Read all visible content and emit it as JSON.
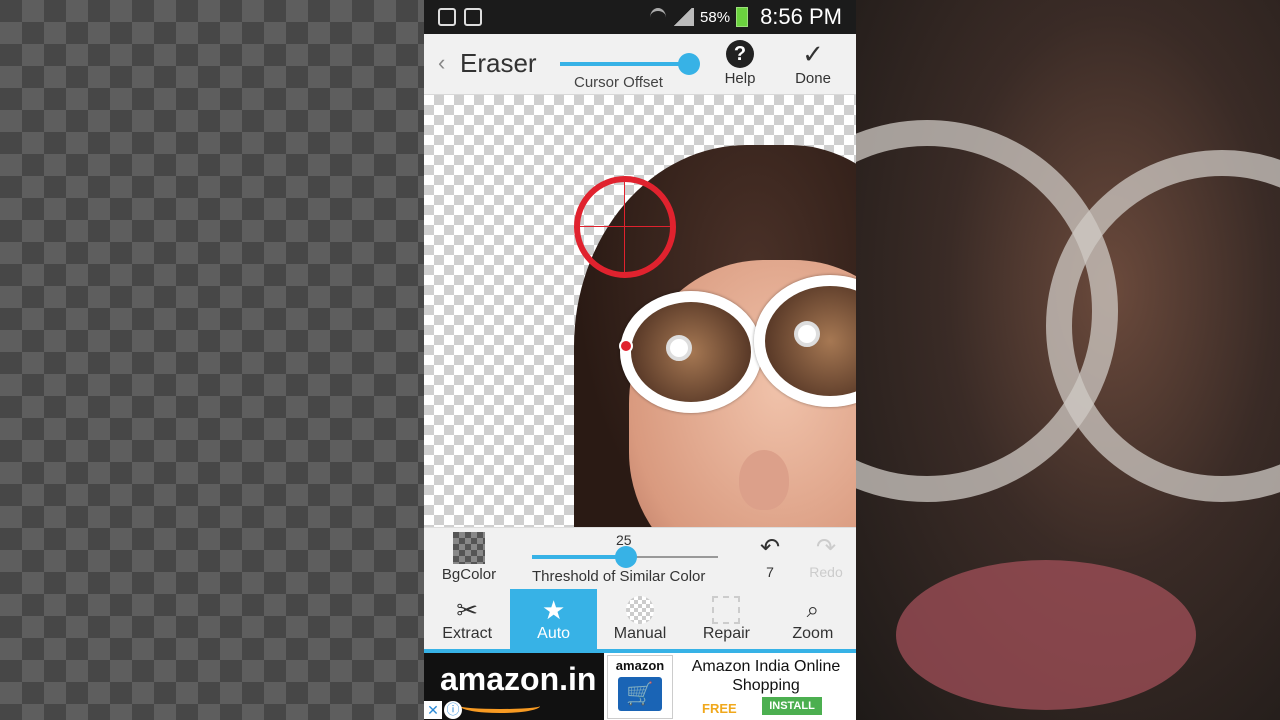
{
  "status_bar": {
    "battery": "58%",
    "time": "8:56 PM"
  },
  "action_bar": {
    "title": "Eraser",
    "cursor_offset_label": "Cursor Offset",
    "help_label": "Help",
    "done_label": "Done",
    "help_glyph": "?",
    "done_glyph": "✓"
  },
  "tools": {
    "bgcolor_label": "BgColor",
    "threshold_value": "25",
    "threshold_label": "Threshold of Similar Color",
    "undo_count": "7",
    "redo_label": "Redo"
  },
  "tabs": [
    {
      "label": "Extract",
      "icon": "scissors-icon",
      "glyph": "✂",
      "active": false
    },
    {
      "label": "Auto",
      "icon": "star-icon",
      "glyph": "★",
      "active": true
    },
    {
      "label": "Manual",
      "icon": "manual-eraser-icon",
      "glyph": "",
      "active": false
    },
    {
      "label": "Repair",
      "icon": "repair-icon",
      "glyph": "",
      "active": false
    },
    {
      "label": "Zoom",
      "icon": "magnifier-icon",
      "glyph": "🔍",
      "active": false
    }
  ],
  "ad": {
    "brand": "amazon.in",
    "logo_word": "amazon",
    "title": "Amazon India Online Shopping",
    "price": "FREE",
    "install": "INSTALL"
  },
  "colors": {
    "accent": "#37b2e6",
    "reticle": "#e0222e"
  }
}
